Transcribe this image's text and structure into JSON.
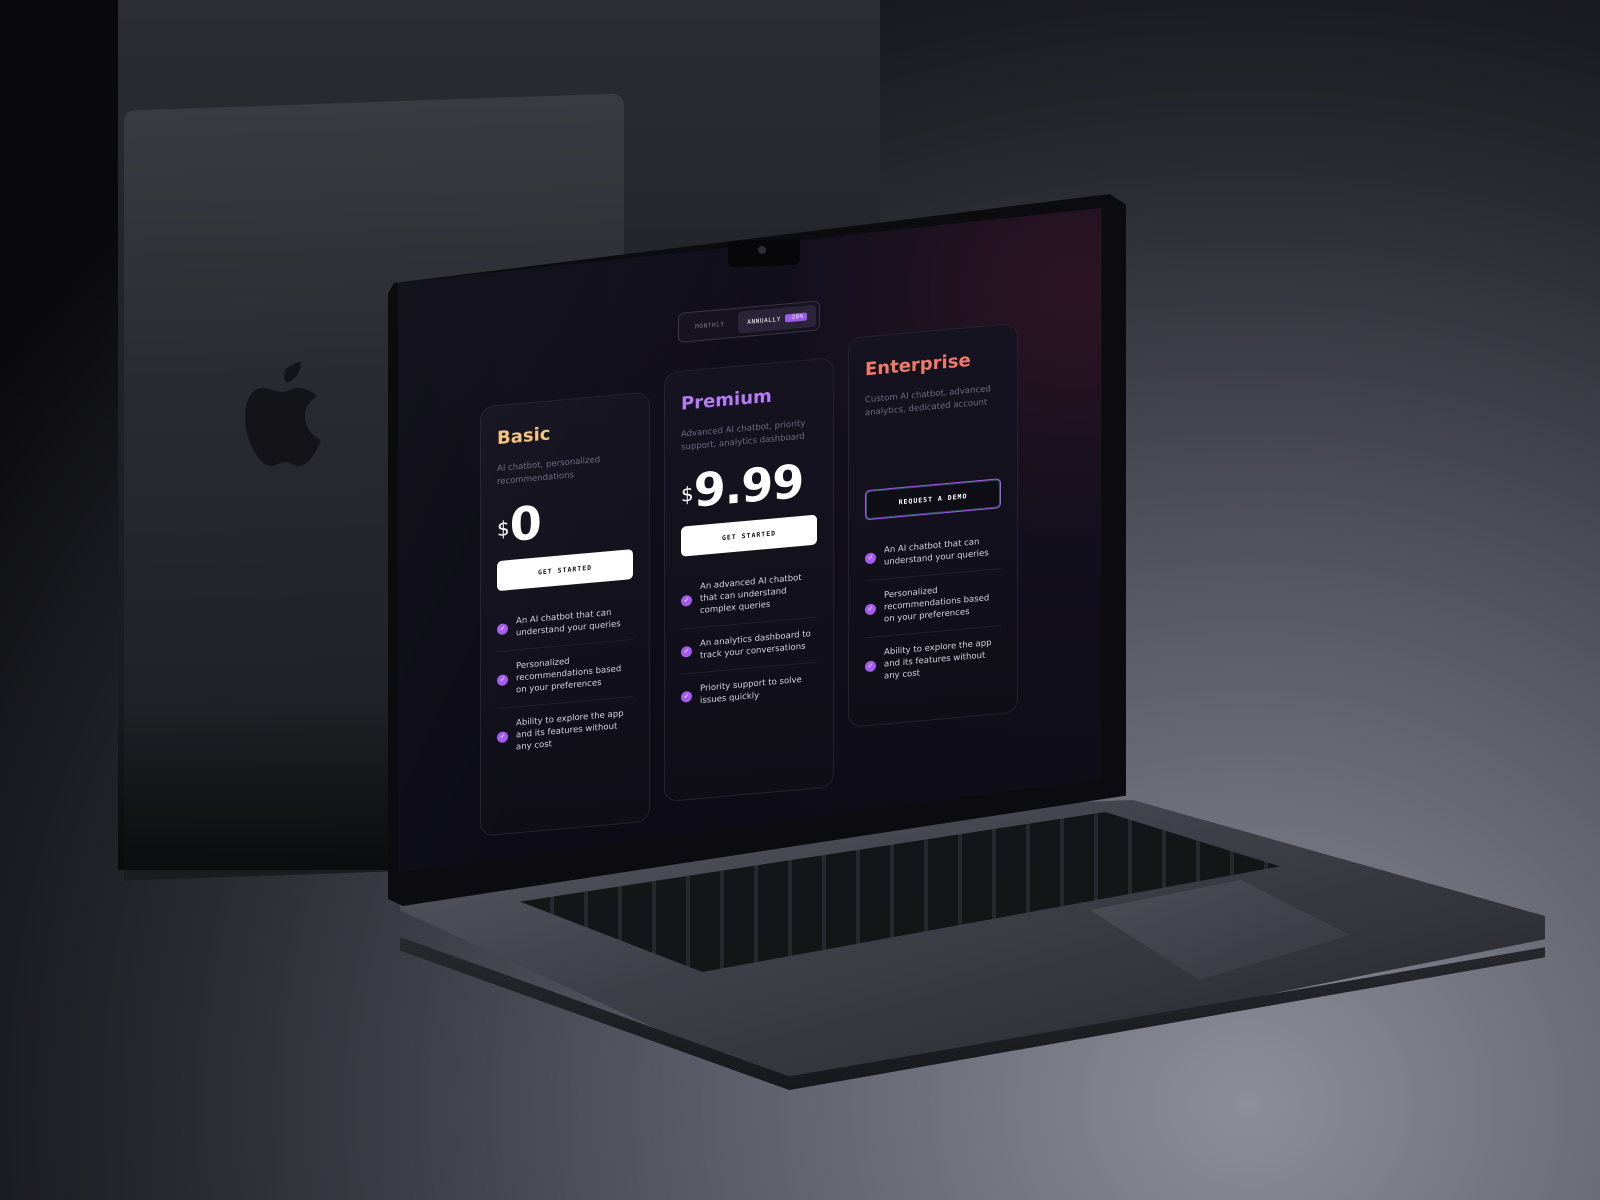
{
  "colors": {
    "accent": "#a45cf0",
    "basic_title": "#f3c47a",
    "premium_title": "#b57cf6",
    "enterprise_title": "#f07a6a"
  },
  "toggle": {
    "monthly_label": "MONTHLY",
    "annually_label": "ANNUALLY",
    "discount_badge": "-20%",
    "selected": "ANNUALLY"
  },
  "plans": [
    {
      "name": "Basic",
      "description": "AI chatbot, personalized recommendations",
      "currency": "$",
      "price": "0",
      "cta_label": "GET STARTED",
      "features": [
        "An AI chatbot that can understand your queries",
        "Personalized recommendations based on your preferences",
        "Ability to explore the app and its features without any cost"
      ]
    },
    {
      "name": "Premium",
      "description": "Advanced AI chatbot, priority support, analytics dashboard",
      "currency": "$",
      "price": "9.99",
      "cta_label": "GET STARTED",
      "features": [
        "An advanced AI chatbot that can understand complex queries",
        "An analytics dashboard to track your conversations",
        "Priority support to solve issues quickly"
      ]
    },
    {
      "name": "Enterprise",
      "description": "Custom AI chatbot, advanced analytics, dedicated account",
      "cta_label": "REQUEST A DEMO",
      "features": [
        "An AI chatbot that can understand your queries",
        "Personalized recommendations based on your preferences",
        "Ability to explore the app and its features without any cost"
      ]
    }
  ],
  "icons": {
    "check": "check-circle-icon",
    "logo": "apple-logo-icon"
  }
}
